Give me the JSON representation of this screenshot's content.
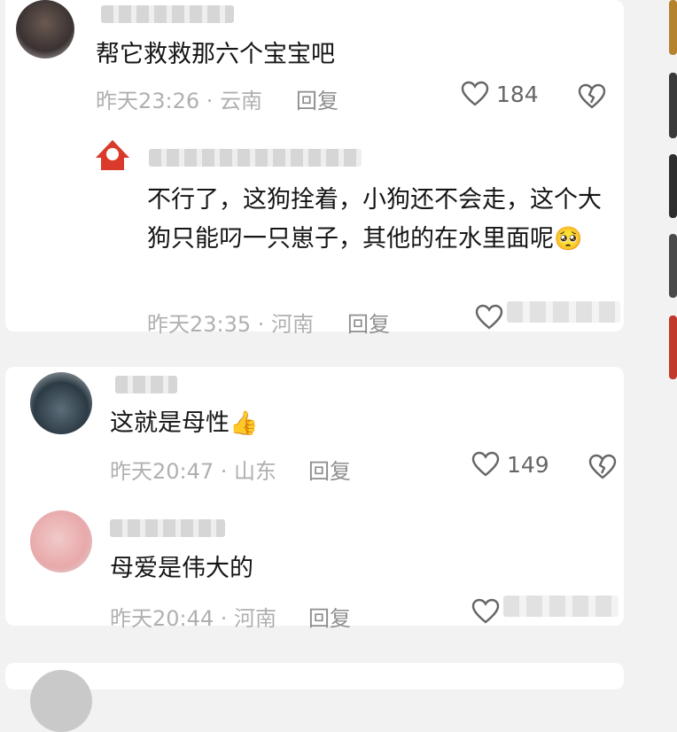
{
  "comments": [
    {
      "text": "帮它救救那六个宝宝吧",
      "time": "昨天23:26 · 云南",
      "reply_label": "回复",
      "likes": "184",
      "sub_reply": {
        "text": "不行了，这狗拴着，小狗还不会走，这个大狗只能叼一只崽子，其他的在水里面呢",
        "emoji": "🥺",
        "time": "昨天23:35 · 河南",
        "reply_label": "回复"
      }
    },
    {
      "text": "这就是母性",
      "emoji": "👍",
      "time": "昨天20:47 · 山东",
      "reply_label": "回复",
      "likes": "149"
    },
    {
      "text": "母爱是伟大的",
      "time": "昨天20:44 · 河南",
      "reply_label": "回复"
    }
  ],
  "colors": {
    "like_icon": "#666666",
    "meta": "#b0b0b0",
    "sidebar": [
      "#b5832e",
      "#3a3a3a",
      "#2e2e2e",
      "#4a4a4a",
      "#c0392b"
    ]
  }
}
